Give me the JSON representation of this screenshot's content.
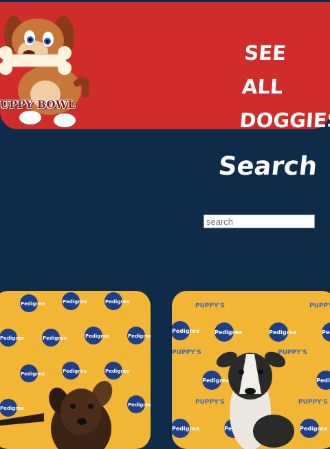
{
  "header": {
    "logo_text": "UPPY BOWL",
    "see_all_line1": "SEE ALL",
    "see_all_line2": "DOGGIES!"
  },
  "search": {
    "title": "Search",
    "placeholder": "search",
    "value": ""
  },
  "cards": [
    {
      "name": "puppy-card-brown"
    },
    {
      "name": "puppy-card-black-white"
    }
  ],
  "backdrop_labels": {
    "brand": "Pedigree",
    "sub": "PUPPY'S"
  },
  "colors": {
    "header_bg": "#d02c2c",
    "page_bg": "#0e2b4a",
    "card_bg": "#f3b534",
    "logo_badge": "#1e3f8a"
  }
}
